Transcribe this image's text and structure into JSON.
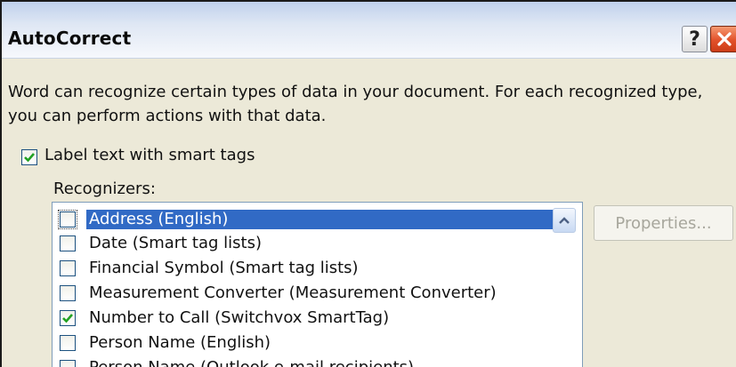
{
  "dialog": {
    "title": "AutoCorrect",
    "help_label": "?",
    "description": "Word can recognize certain types of data in your document. For each recognized type, you can perform actions with that data."
  },
  "smart_tags": {
    "checkbox_label": "Label text with smart tags",
    "checked": true
  },
  "recognizers": {
    "label": "Recognizers:",
    "items": [
      {
        "label": "Address (English)",
        "checked": false,
        "selected": true
      },
      {
        "label": "Date (Smart tag lists)",
        "checked": false,
        "selected": false
      },
      {
        "label": "Financial Symbol (Smart tag lists)",
        "checked": false,
        "selected": false
      },
      {
        "label": "Measurement Converter (Measurement Converter)",
        "checked": false,
        "selected": false
      },
      {
        "label": "Number to Call (Switchvox SmartTag)",
        "checked": true,
        "selected": false
      },
      {
        "label": "Person Name (English)",
        "checked": false,
        "selected": false
      },
      {
        "label": "Person Name (Outlook e-mail recipients)",
        "checked": false,
        "selected": false
      }
    ]
  },
  "properties_button": {
    "label": "Properties...",
    "enabled": false
  },
  "colors": {
    "selection": "#316ac5",
    "check": "#21a121",
    "close_button": "#e2512a"
  },
  "icons": {
    "help": "help-icon",
    "close": "close-icon",
    "scroll_up": "scroll-up-arrow-icon",
    "checkmark": "checkmark-icon"
  }
}
